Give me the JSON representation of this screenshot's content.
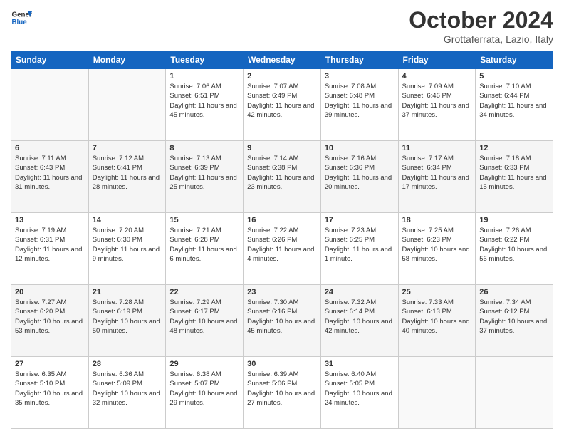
{
  "header": {
    "logo_line1": "General",
    "logo_line2": "Blue",
    "month": "October 2024",
    "location": "Grottaferrata, Lazio, Italy"
  },
  "weekdays": [
    "Sunday",
    "Monday",
    "Tuesday",
    "Wednesday",
    "Thursday",
    "Friday",
    "Saturday"
  ],
  "weeks": [
    [
      {
        "day": "",
        "info": ""
      },
      {
        "day": "",
        "info": ""
      },
      {
        "day": "1",
        "info": "Sunrise: 7:06 AM\nSunset: 6:51 PM\nDaylight: 11 hours and 45 minutes."
      },
      {
        "day": "2",
        "info": "Sunrise: 7:07 AM\nSunset: 6:49 PM\nDaylight: 11 hours and 42 minutes."
      },
      {
        "day": "3",
        "info": "Sunrise: 7:08 AM\nSunset: 6:48 PM\nDaylight: 11 hours and 39 minutes."
      },
      {
        "day": "4",
        "info": "Sunrise: 7:09 AM\nSunset: 6:46 PM\nDaylight: 11 hours and 37 minutes."
      },
      {
        "day": "5",
        "info": "Sunrise: 7:10 AM\nSunset: 6:44 PM\nDaylight: 11 hours and 34 minutes."
      }
    ],
    [
      {
        "day": "6",
        "info": "Sunrise: 7:11 AM\nSunset: 6:43 PM\nDaylight: 11 hours and 31 minutes."
      },
      {
        "day": "7",
        "info": "Sunrise: 7:12 AM\nSunset: 6:41 PM\nDaylight: 11 hours and 28 minutes."
      },
      {
        "day": "8",
        "info": "Sunrise: 7:13 AM\nSunset: 6:39 PM\nDaylight: 11 hours and 25 minutes."
      },
      {
        "day": "9",
        "info": "Sunrise: 7:14 AM\nSunset: 6:38 PM\nDaylight: 11 hours and 23 minutes."
      },
      {
        "day": "10",
        "info": "Sunrise: 7:16 AM\nSunset: 6:36 PM\nDaylight: 11 hours and 20 minutes."
      },
      {
        "day": "11",
        "info": "Sunrise: 7:17 AM\nSunset: 6:34 PM\nDaylight: 11 hours and 17 minutes."
      },
      {
        "day": "12",
        "info": "Sunrise: 7:18 AM\nSunset: 6:33 PM\nDaylight: 11 hours and 15 minutes."
      }
    ],
    [
      {
        "day": "13",
        "info": "Sunrise: 7:19 AM\nSunset: 6:31 PM\nDaylight: 11 hours and 12 minutes."
      },
      {
        "day": "14",
        "info": "Sunrise: 7:20 AM\nSunset: 6:30 PM\nDaylight: 11 hours and 9 minutes."
      },
      {
        "day": "15",
        "info": "Sunrise: 7:21 AM\nSunset: 6:28 PM\nDaylight: 11 hours and 6 minutes."
      },
      {
        "day": "16",
        "info": "Sunrise: 7:22 AM\nSunset: 6:26 PM\nDaylight: 11 hours and 4 minutes."
      },
      {
        "day": "17",
        "info": "Sunrise: 7:23 AM\nSunset: 6:25 PM\nDaylight: 11 hours and 1 minute."
      },
      {
        "day": "18",
        "info": "Sunrise: 7:25 AM\nSunset: 6:23 PM\nDaylight: 10 hours and 58 minutes."
      },
      {
        "day": "19",
        "info": "Sunrise: 7:26 AM\nSunset: 6:22 PM\nDaylight: 10 hours and 56 minutes."
      }
    ],
    [
      {
        "day": "20",
        "info": "Sunrise: 7:27 AM\nSunset: 6:20 PM\nDaylight: 10 hours and 53 minutes."
      },
      {
        "day": "21",
        "info": "Sunrise: 7:28 AM\nSunset: 6:19 PM\nDaylight: 10 hours and 50 minutes."
      },
      {
        "day": "22",
        "info": "Sunrise: 7:29 AM\nSunset: 6:17 PM\nDaylight: 10 hours and 48 minutes."
      },
      {
        "day": "23",
        "info": "Sunrise: 7:30 AM\nSunset: 6:16 PM\nDaylight: 10 hours and 45 minutes."
      },
      {
        "day": "24",
        "info": "Sunrise: 7:32 AM\nSunset: 6:14 PM\nDaylight: 10 hours and 42 minutes."
      },
      {
        "day": "25",
        "info": "Sunrise: 7:33 AM\nSunset: 6:13 PM\nDaylight: 10 hours and 40 minutes."
      },
      {
        "day": "26",
        "info": "Sunrise: 7:34 AM\nSunset: 6:12 PM\nDaylight: 10 hours and 37 minutes."
      }
    ],
    [
      {
        "day": "27",
        "info": "Sunrise: 6:35 AM\nSunset: 5:10 PM\nDaylight: 10 hours and 35 minutes."
      },
      {
        "day": "28",
        "info": "Sunrise: 6:36 AM\nSunset: 5:09 PM\nDaylight: 10 hours and 32 minutes."
      },
      {
        "day": "29",
        "info": "Sunrise: 6:38 AM\nSunset: 5:07 PM\nDaylight: 10 hours and 29 minutes."
      },
      {
        "day": "30",
        "info": "Sunrise: 6:39 AM\nSunset: 5:06 PM\nDaylight: 10 hours and 27 minutes."
      },
      {
        "day": "31",
        "info": "Sunrise: 6:40 AM\nSunset: 5:05 PM\nDaylight: 10 hours and 24 minutes."
      },
      {
        "day": "",
        "info": ""
      },
      {
        "day": "",
        "info": ""
      }
    ]
  ]
}
